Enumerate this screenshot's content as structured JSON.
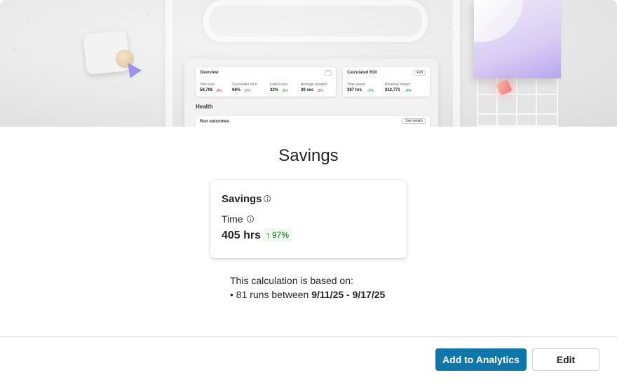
{
  "hero": {
    "overview": {
      "title": "Overview",
      "metrics": [
        {
          "label": "Total runs",
          "value": "58,706",
          "trend": "9%",
          "direction": "down"
        },
        {
          "label": "Successful runs",
          "value": "68%",
          "trend": "2%",
          "direction": "up"
        },
        {
          "label": "Failed runs",
          "value": "32%",
          "trend": "5%",
          "direction": "down"
        },
        {
          "label": "Average duration",
          "value": "30 sec",
          "trend": "3%",
          "direction": "up"
        }
      ]
    },
    "roi": {
      "title": "Calculated ROI",
      "edit_label": "Edit",
      "metrics": [
        {
          "label": "Time saved",
          "value": "387 hrs",
          "trend": "5%",
          "direction": "up"
        },
        {
          "label": "Revenue impact",
          "value": "$12,771",
          "trend": "8%",
          "direction": "up"
        }
      ]
    },
    "health_label": "Health",
    "run_outcomes_label": "Run outcomes",
    "see_details_label": "See details"
  },
  "dialog": {
    "title": "Savings"
  },
  "card": {
    "title": "Savings",
    "metric_label": "Time",
    "metric_value": "405 hrs",
    "trend": "97%",
    "trend_direction": "up"
  },
  "calculation": {
    "intro": "This calculation is based on:",
    "bullet_prefix": "• 81 runs between ",
    "date_range": "9/11/25 - 9/17/25"
  },
  "actions": {
    "primary_label": "Add to Analytics",
    "secondary_label": "Edit"
  },
  "colors": {
    "primary": "#0e76a8",
    "trend_positive": "#0e700e",
    "trend_positive_bg": "#f1faf1"
  }
}
